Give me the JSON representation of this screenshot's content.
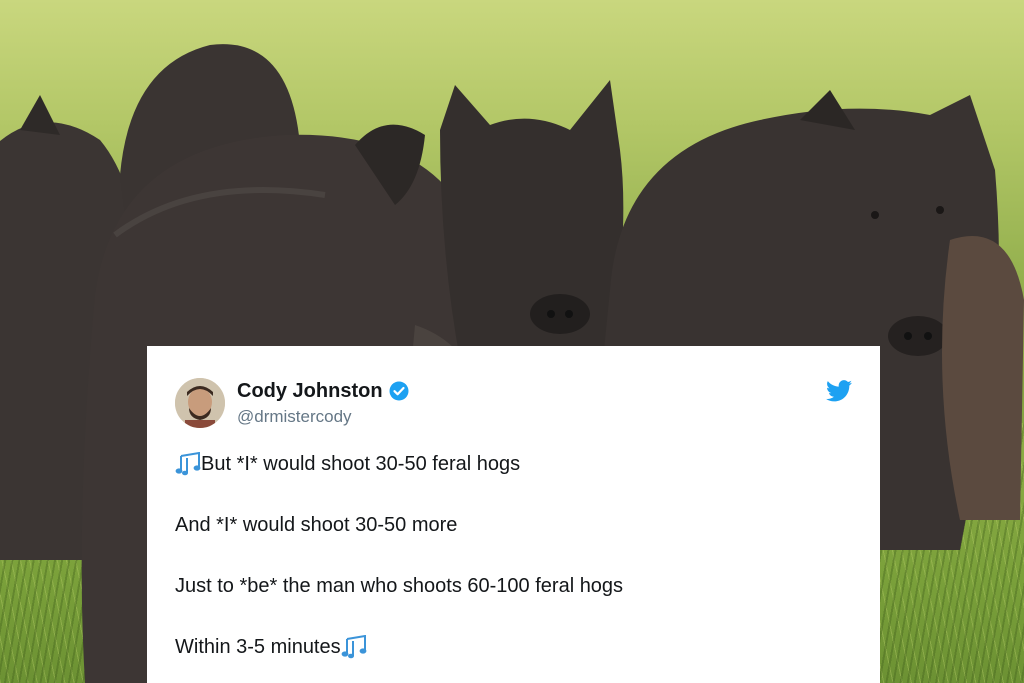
{
  "image": {
    "scene": "feral-hogs-in-grass",
    "colors": {
      "grass_light": "#c9d77e",
      "grass_dark": "#6f9236",
      "hog_fur": "#3a3532"
    }
  },
  "tweet": {
    "display_name": "Cody Johnston",
    "handle": "@drmistercody",
    "verified": true,
    "brand_icon": "twitter-bird-icon",
    "lines": [
      {
        "lead_icon": "musical-notes-icon",
        "text": "But *I* would shoot 30-50 feral hogs"
      },
      {
        "text": "And *I* would shoot 30-50 more"
      },
      {
        "text": "Just to *be* the man who shoots 60-100 feral hogs"
      },
      {
        "text": "Within 3-5 minutes",
        "trail_icon": "musical-notes-icon"
      }
    ],
    "colors": {
      "card": "#ffffff",
      "text": "#14171a",
      "handle": "#657786",
      "brand": "#1da1f2"
    }
  }
}
